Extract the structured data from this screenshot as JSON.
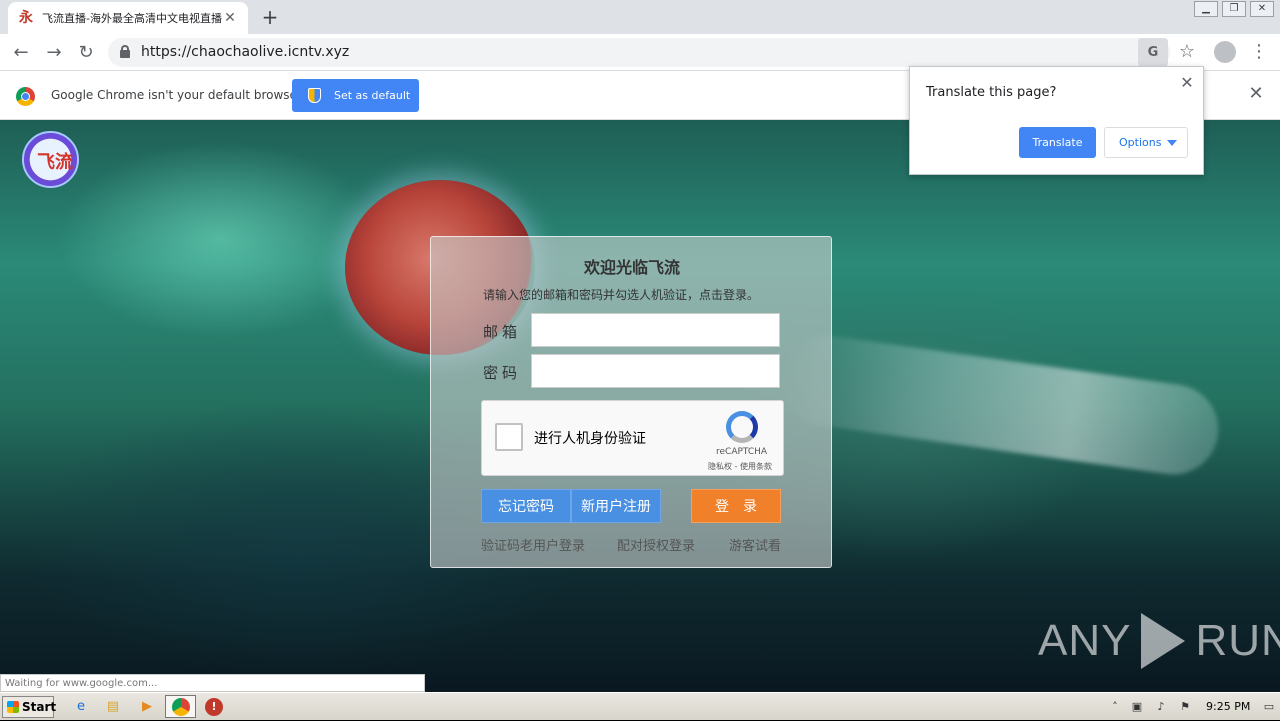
{
  "browser": {
    "tab_title": "飞流直播-海外最全高清中文电视直播",
    "favicon_glyph": "永",
    "url": "https://chaochaolive.icntv.xyz",
    "infobar_message": "Google Chrome isn't your default browser",
    "infobar_button": "Set as default",
    "translate_prompt": "Translate this page?",
    "translate_button": "Translate",
    "options_button": "Options",
    "status_text": "Waiting for www.google.com..."
  },
  "login": {
    "title": "欢迎光临飞流",
    "hint": "请输入您的邮箱和密码并勾选人机验证，点击登录。",
    "email_label": "邮箱",
    "password_label": "密码",
    "email_value": "",
    "password_value": "",
    "captcha_label": "进行人机身份验证",
    "captcha_brand": "reCAPTCHA",
    "captcha_terms": "隐私权 - 使用条款",
    "forgot_button": "忘记密码",
    "register_button": "新用户注册",
    "login_button": "登　录",
    "link_code_login": "验证码老用户登录",
    "link_authorized_login": "配对授权登录",
    "link_guest": "游客试看"
  },
  "site_logo_text": "飞流",
  "watermark": {
    "left": "ANY",
    "right": "RUN"
  },
  "taskbar": {
    "start_label": "Start",
    "clock": "9:25 PM"
  }
}
